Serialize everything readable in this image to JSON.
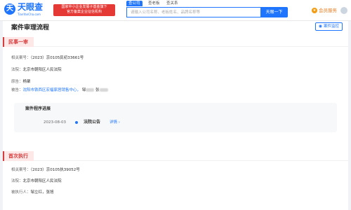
{
  "header": {
    "logo_mark": "天",
    "logo_text": "天眼查",
    "logo_url": "TianYanCha.com",
    "promo_line1": "国家中小企业发展子基金旗下",
    "promo_line2": "官方备案企业征信机构",
    "search_tabs": [
      "查公司",
      "查老板",
      "查关系"
    ],
    "search_placeholder": "请输入公司名称、老板姓名、品牌名称等",
    "search_button": "天眼一下",
    "vip_label": "会员服务",
    "vip_icon_glyph": "★"
  },
  "page": {
    "title": "案件审理流程",
    "monitor_label": "案件监控",
    "monitor_icon": "◉"
  },
  "sections": [
    {
      "tag": "民事一审",
      "fields": [
        {
          "label": "相关案号：",
          "value": "（2023）京0105民初33661号"
        },
        {
          "label": "法院：",
          "value": "北京市朝阳区人民法院"
        },
        {
          "label": "原告：",
          "value": "杨聚"
        },
        {
          "label": "被告：",
          "value": "沈阳市铁西区宏福家居销售中心，",
          "extra1": "邹",
          "extra2": "张"
        }
      ],
      "progress": {
        "title": "案件程序进展",
        "date": "2023-08-03",
        "type": "法院公告",
        "link": "详情 ›"
      }
    },
    {
      "tag": "首次执行",
      "fields": [
        {
          "label": "相关案号：",
          "value": "（2023）京0105执39052号"
        },
        {
          "label": "法院：",
          "value": "北京市朝阳区人民法院"
        },
        {
          "label": "被执行人：",
          "value": "邹立红，张旭"
        }
      ]
    }
  ]
}
